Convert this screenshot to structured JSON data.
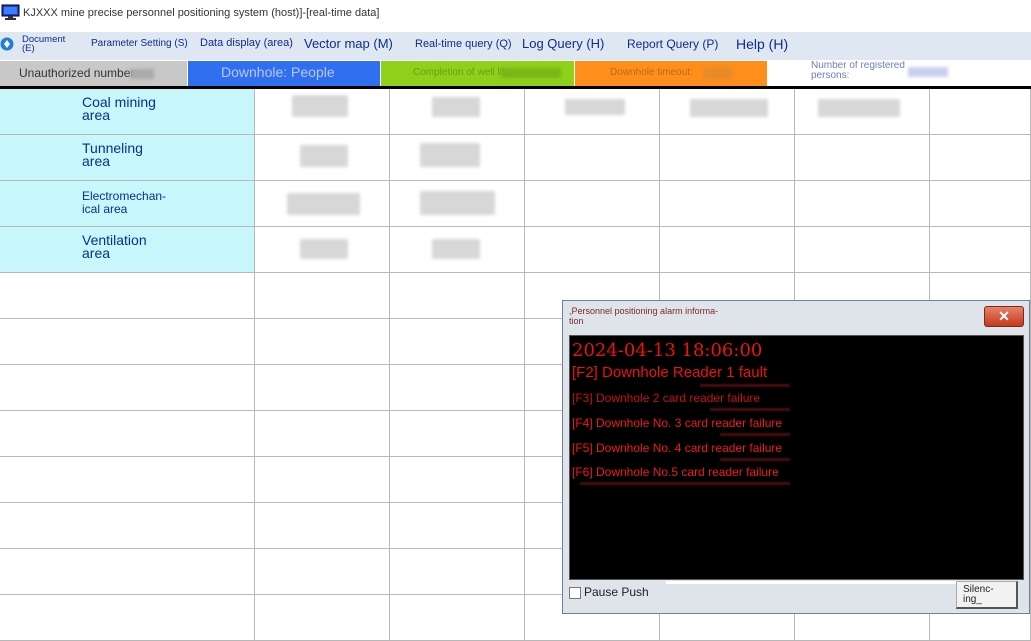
{
  "window": {
    "title": "KJXXX mine precise personnel positioning system (host)]-[real-time data]"
  },
  "menu": {
    "document": "Document\n(E)",
    "parameter_setting": "Parameter Setting (S)",
    "data_display": "Data display (area)",
    "vector_map": "Vector map (M)",
    "realtime_query": "Real-time query (Q)",
    "log_query": "Log Query (H)",
    "report_query": "Report Query (P)",
    "help": "Help (H)"
  },
  "status": {
    "unauthorized": "Unauthorized number:",
    "downhole_people": "Downhole: People",
    "completion": "Completion of well lif...",
    "downhole_timeout": "Downhole timeout:",
    "registered": "Number of registered\npersons:"
  },
  "status_colors": {
    "unauthorized": "#c8c8c8",
    "downhole_people": "#2f6ff0",
    "completion": "#8fd11a",
    "downhole_timeout": "#ff8f1a",
    "registered": "#ffffff"
  },
  "areas": [
    {
      "label": "Coal mining\narea"
    },
    {
      "label": "Tunneling\narea"
    },
    {
      "label": "Electromechan-\nical area"
    },
    {
      "label": "Ventilation\narea"
    }
  ],
  "alarm_dialog": {
    "title": ",Personnel positioning alarm informa-\ntion",
    "close_label": "✕",
    "timestamp": "2024-04-13  18:06:00",
    "messages": [
      "[F2] Downhole Reader 1 fault",
      "[F3] Downhole 2 card reader failure",
      "[F4] Downhole No. 3 card reader failure",
      "[F5] Downhole No. 4 card reader failure",
      "[F6] Downhole No.5 card reader failure"
    ],
    "pause_label": "Pause Push",
    "silence_label": "Silenc-\ning_"
  }
}
